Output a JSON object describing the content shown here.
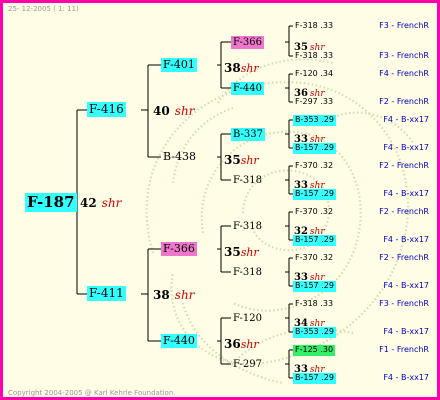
{
  "header": {
    "date": "25- 12-2005 ( 1: 11)"
  },
  "footer": {
    "copyright": "Copyright 2004-2005 @ Karl Kehrle Foundation."
  },
  "root": {
    "id": "F-187",
    "score": "42",
    "unit": "shr"
  },
  "gen1": [
    {
      "id": "F-416",
      "score": "40",
      "unit": "shr"
    },
    {
      "id": "F-411",
      "score": "38",
      "unit": "shr"
    }
  ],
  "gen2": [
    {
      "id": "F-401",
      "score": "38",
      "unit": "shr"
    },
    {
      "id": "B-438",
      "score": "35",
      "unit": "shr"
    },
    {
      "id": "F-366",
      "score": "35",
      "unit": "shr"
    },
    {
      "id": "F-440",
      "score": "36",
      "unit": "shr"
    }
  ],
  "gen3": [
    {
      "id": "F-366",
      "score": "35",
      "unit": "shr"
    },
    {
      "id": "F-440",
      "score": "36",
      "unit": "shr"
    },
    {
      "id": "B-337",
      "score": "33",
      "unit": "shr"
    },
    {
      "id": "F-318",
      "score": "33",
      "unit": "shr"
    },
    {
      "id": "F-318",
      "score": "32",
      "unit": "shr"
    },
    {
      "id": "F-318",
      "score": "33",
      "unit": "shr"
    },
    {
      "id": "F-120",
      "score": "34",
      "unit": "shr"
    },
    {
      "id": "F-297",
      "score": "33",
      "unit": "shr"
    }
  ],
  "gen4": [
    {
      "id": "F-318",
      "num": ".33"
    },
    {
      "id": "F-318",
      "num": ".33"
    },
    {
      "id": "F-120",
      "num": ".34"
    },
    {
      "id": "F-297",
      "num": ".33"
    },
    {
      "id": "B-353",
      "num": ".29"
    },
    {
      "id": "B-157",
      "num": ".29"
    },
    {
      "id": "F-370",
      "num": ".32"
    },
    {
      "id": "B-157",
      "num": ".29"
    },
    {
      "id": "F-370",
      "num": ".32"
    },
    {
      "id": "B-157",
      "num": ".29"
    },
    {
      "id": "F-370",
      "num": ".32"
    },
    {
      "id": "B-157",
      "num": ".29"
    },
    {
      "id": "F-318",
      "num": ".33"
    },
    {
      "id": "B-353",
      "num": ".29"
    },
    {
      "id": "F-125",
      "num": ".30"
    },
    {
      "id": "B-157",
      "num": ".29"
    }
  ],
  "origins": [
    "F3 - FrenchR",
    "F3 - FrenchR",
    "F4 - FrenchR",
    "F2 - FrenchR",
    "F4 - B-xx17",
    "F4 - B-xx17",
    "F2 - FrenchR",
    "F4 - B-xx17",
    "F2 - FrenchR",
    "F4 - B-xx17",
    "F2 - FrenchR",
    "F4 - B-xx17",
    "F3 - FrenchR",
    "F4 - B-xx17",
    "F1 - FrenchR",
    "F4 - B-xx17"
  ]
}
